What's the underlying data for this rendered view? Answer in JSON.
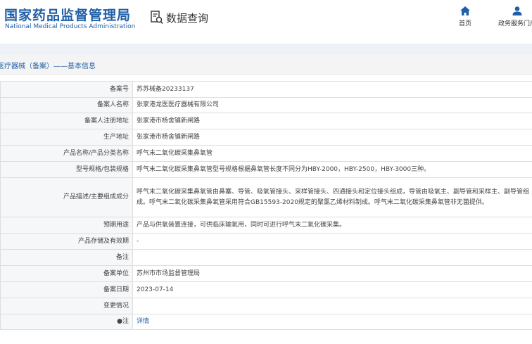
{
  "header": {
    "agency_cn": "国家药品监督管理局",
    "agency_en": "National Medical Products Administration",
    "query_title": "数据查询",
    "nav": [
      {
        "label": "首页",
        "icon": "home-icon"
      },
      {
        "label": "政务服务门户",
        "icon": "user-icon"
      }
    ]
  },
  "breadcrumb": "医疗器械（备案）——基本信息",
  "colors": {
    "brand": "#1f5fa8",
    "label_bg": "#f6f7f9",
    "border": "#dedede"
  },
  "rows": [
    {
      "label": "备案号",
      "value": "苏苏械备20233137"
    },
    {
      "label": "备案人名称",
      "value": "张家港龙医医疗器械有限公司"
    },
    {
      "label": "备案人注册地址",
      "value": "张家港市杨舍镇新闸路"
    },
    {
      "label": "生产地址",
      "value": "张家港市杨舍镇新闸路"
    },
    {
      "label": "产品名称/产品分类名称",
      "value": "呼气末二氧化碳采集鼻氧管"
    },
    {
      "label": "型号规格/包装规格",
      "value": "呼气末二氧化碳采集鼻氧管型号规格根据鼻氧管长度不同分为HBY-2000，HBY-2500，HBY-3000三种。"
    },
    {
      "label": "产品描述/主要组成成分",
      "value": "呼气末二氧化碳采集鼻氧管由鼻塞、导管、吸氧管接头、采样管接头、四通接头和定位接头组成，导管由吸氧主、副导管和采样主、副导管组成。呼气末二氧化碳采集鼻氧管采用符合GB15593-2020规定的聚氯乙烯材料制成。呼气末二氧化碳采集鼻氧管非无菌提供。"
    },
    {
      "label": "预期用途",
      "value": "产品与供氧装置连接，可供临床输氧用，同时可进行呼气末二氧化碳采集。"
    },
    {
      "label": "产品存储及有效期",
      "value": "-"
    },
    {
      "label": "备注",
      "value": ""
    },
    {
      "label": "备案单位",
      "value": "苏州市市场监督管理局"
    },
    {
      "label": "备案日期",
      "value": "2023-07-14"
    },
    {
      "label": "变更情况",
      "value": ""
    },
    {
      "label": "●注",
      "value": "详情"
    }
  ]
}
